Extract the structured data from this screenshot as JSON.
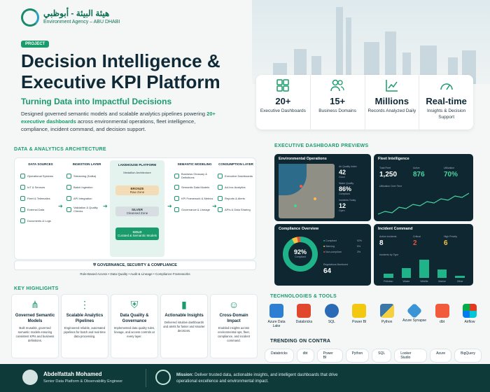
{
  "header": {
    "arabic_name": "هيئة البيئة - أبوظبي",
    "agency_name": "Environment Agency – ABU DHABI",
    "badge": "PROJECT",
    "title": "Decision Intelligence & Executive KPI Platform",
    "subtitle": "Turning Data into Impactful Decisions",
    "desc_1": "Designed governed semantic models and scalable analytics pipelines powering ",
    "desc_hl": "20+ executive dashboards",
    "desc_2": " across environmental operations, fleet intelligence, compliance, incident command, and decision support."
  },
  "kpis": [
    {
      "icon": "grid-icon",
      "value": "20+",
      "label": "Executive Dashboards"
    },
    {
      "icon": "people-icon",
      "value": "15+",
      "label": "Business Domains"
    },
    {
      "icon": "trend-icon",
      "value": "Millions",
      "label": "Records Analyzed Daily"
    },
    {
      "icon": "gauge-icon",
      "value": "Real-time",
      "label": "Insights & Decision Support"
    }
  ],
  "architecture": {
    "section_title": "DATA & ANALYTICS ARCHITECTURE",
    "columns": [
      {
        "title": "DATA SOURCES",
        "items": [
          "Operational Systems",
          "IoT & Sensors",
          "Fleet & Telematics",
          "External Data",
          "Documents & Logs"
        ]
      },
      {
        "title": "INGESTION LAYER",
        "items": [
          "Streaming (Kafka)",
          "Batch Ingestion",
          "API Integration",
          "Validation & Quality Checks"
        ]
      },
      {
        "title": "LAKEHOUSE PLATFORM",
        "items": [
          "Medallion Architecture"
        ]
      },
      {
        "title": "SEMANTIC MODELING",
        "items": [
          "Business Glossary & Definitions",
          "Semantic Data Models",
          "KPI Framework & Metrics",
          "Governance & Lineage"
        ]
      },
      {
        "title": "CONSUMPTION LAYER",
        "items": [
          "Executive Dashboards",
          "Ad-hoc Analytics",
          "Reports & Alerts",
          "APIs & Data Sharing"
        ]
      }
    ],
    "medallion": [
      {
        "name": "BRONZE",
        "sub": "Raw Zone"
      },
      {
        "name": "SILVER",
        "sub": "Cleansed Zone"
      },
      {
        "name": "GOLD",
        "sub": "Curated & Semantic Models"
      }
    ],
    "governance": "GOVERNANCE, SECURITY & COMPLIANCE",
    "governance_sub": "Role-Based Access  •  Data Quality  •  Audit & Lineage  •  Compliance Frameworks"
  },
  "highlights": {
    "section_title": "KEY HIGHLIGHTS",
    "items": [
      {
        "title": "Governed Semantic Models",
        "desc": "Built reusable, governed semantic models ensuring consistent KPIs and business definitions."
      },
      {
        "title": "Scalable Analytics Pipelines",
        "desc": "Engineered reliable, automated pipelines for batch and real-time data processing."
      },
      {
        "title": "Data Quality & Governance",
        "desc": "Implemented data quality rules, lineage, and access controls at every layer."
      },
      {
        "title": "Actionable Insights",
        "desc": "Delivered intuitive dashboards and alerts for faster and smarter decisions."
      },
      {
        "title": "Cross-Domain Impact",
        "desc": "Enabled insights across environmental ops, fleet, compliance, and incident command."
      }
    ]
  },
  "dashboards": {
    "section_title": "EXECUTIVE DASHBOARD PREVIEWS",
    "env": {
      "title": "Environmental Operations",
      "m1": "Air Quality Index",
      "v1": "42",
      "m1s": "Good",
      "m2": "Water Quality",
      "v2": "86%",
      "m2s": "Compliant",
      "m3": "Incidents Today",
      "v3": "12",
      "m3s": "Open"
    },
    "fleet": {
      "title": "Fleet Intelligence",
      "k1": "Total Fleet",
      "v1": "1,250",
      "k2": "Active",
      "v2": "876",
      "k3": "Utilization",
      "v3": "70%",
      "chart": "Utilization Over Time"
    },
    "compliance": {
      "title": "Compliance Overview",
      "pct": "92%",
      "pct_l": "Compliant",
      "l1": "Compliant",
      "p1": "92%",
      "l2": "Warning",
      "p2": "5%",
      "l3": "Non-compliant",
      "p3": "3%",
      "reg": "Regulations Monitored",
      "reg_v": "64"
    },
    "incident": {
      "title": "Incident Command",
      "a": "Active Incidents",
      "av": "8",
      "c": "Critical",
      "cv": "2",
      "h": "High Priority",
      "hv": "6",
      "chart": "Incidents by Type",
      "types": [
        "Pollution",
        "Waste",
        "Wildlife",
        "Marine",
        "Other"
      ],
      "values": [
        2,
        5,
        9,
        4,
        1
      ]
    }
  },
  "tech": {
    "section_title": "TECHNOLOGIES & TOOLS",
    "items": [
      {
        "label": "Azure Data Lake",
        "color": "#2d7fd3"
      },
      {
        "label": "Databricks",
        "color": "#e0472c"
      },
      {
        "label": "SQL",
        "color": "#2b6bb5"
      },
      {
        "label": "Power BI",
        "color": "#f2c811"
      },
      {
        "label": "Python",
        "color": "#3b77a8"
      },
      {
        "label": "Azure Synapse",
        "color": "#3a94d6"
      },
      {
        "label": "dbt",
        "color": "#f15a3a"
      },
      {
        "label": "Airflow",
        "color": "#17a4c5"
      }
    ],
    "trending_title": "TRENDING ON CONTRA",
    "trending": [
      "Databricks",
      "dbt",
      "Power BI",
      "Python",
      "SQL",
      "Looker Studio",
      "Azure",
      "BigQuery"
    ]
  },
  "footer": {
    "name": "Abdelfattah Mohamed",
    "role": "Senior Data Platform & Observability Engineer",
    "mission_label": "Mission:",
    "mission": " Deliver trusted data, actionable insights, and intelligent dashboards that drive operational excellence and environmental impact."
  }
}
